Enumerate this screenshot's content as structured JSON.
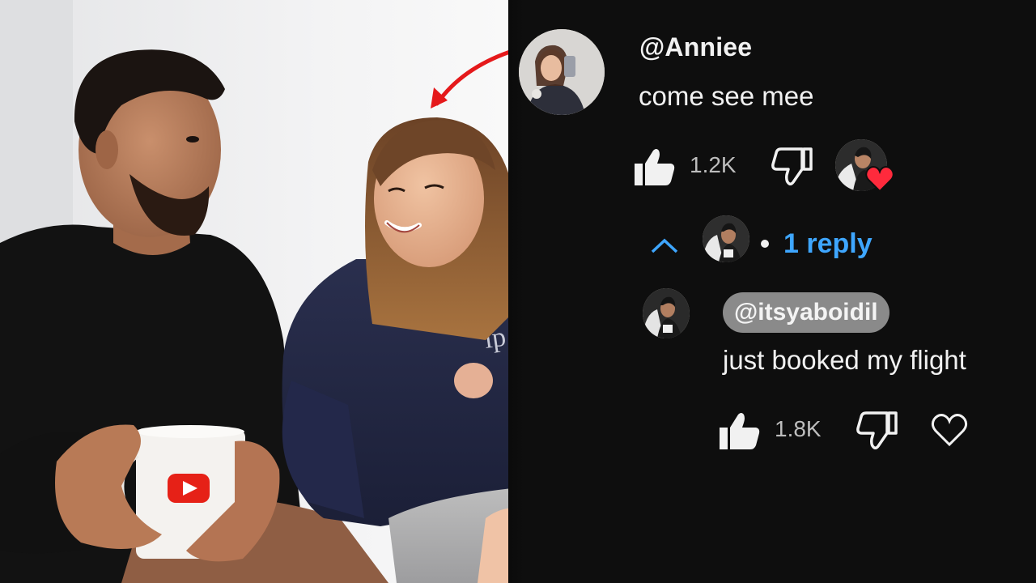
{
  "photo": {
    "description_icon": "youtube-logo-icon"
  },
  "comment": {
    "handle": "@Anniee",
    "text": "come see mee",
    "like_count": "1.2K",
    "like_icon": "thumbs-up-icon",
    "dislike_icon": "thumbs-down-icon",
    "creator_heart_icon": "creator-heart-icon",
    "heart_color": "#ff2a3c"
  },
  "replies": {
    "toggle_icon": "chevron-up-icon",
    "count_label": "1 reply",
    "link_color": "#3ea6ff"
  },
  "reply": {
    "handle": "@itsyaboidil",
    "text": "just booked my flight",
    "like_count": "1.8K",
    "like_icon": "thumbs-up-icon",
    "dislike_icon": "thumbs-down-icon",
    "heart_icon": "heart-outline-icon"
  },
  "annotation": {
    "arrow_icon": "red-arrow-icon",
    "arrow_color": "#e5191b"
  }
}
